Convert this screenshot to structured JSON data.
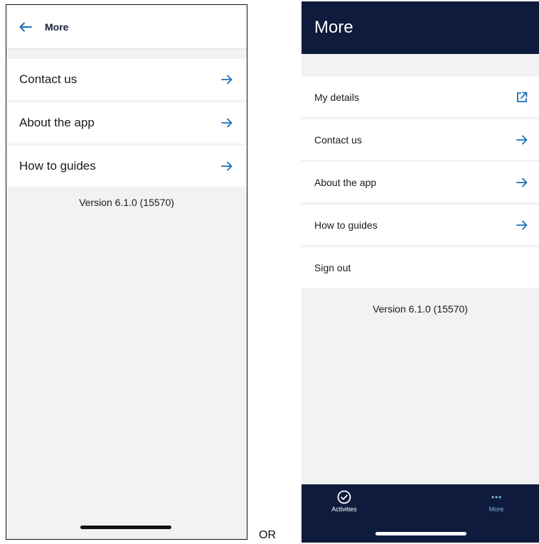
{
  "colors": {
    "accent": "#1a6fb5",
    "navy": "#0f1b3d",
    "more_tab": "#7fb2e0"
  },
  "left_screen": {
    "title": "More",
    "items": [
      {
        "label": "Contact us",
        "icon": "arrow-right-icon"
      },
      {
        "label": "About the app",
        "icon": "arrow-right-icon"
      },
      {
        "label": "How to guides",
        "icon": "arrow-right-icon"
      }
    ],
    "version": "Version 6.1.0 (15570)"
  },
  "separator": "OR",
  "right_screen": {
    "title": "More",
    "items": [
      {
        "label": "My details",
        "icon": "external-link-icon"
      },
      {
        "label": "Contact us",
        "icon": "arrow-right-icon"
      },
      {
        "label": "About the app",
        "icon": "arrow-right-icon"
      },
      {
        "label": "How to guides",
        "icon": "arrow-right-icon"
      },
      {
        "label": "Sign out",
        "icon": ""
      }
    ],
    "version": "Version 6.1.0 (15570)",
    "tabs": [
      {
        "label": "Activities",
        "icon": "check-circle-icon"
      },
      {
        "label": "More",
        "icon": "more-dots-icon"
      }
    ]
  }
}
